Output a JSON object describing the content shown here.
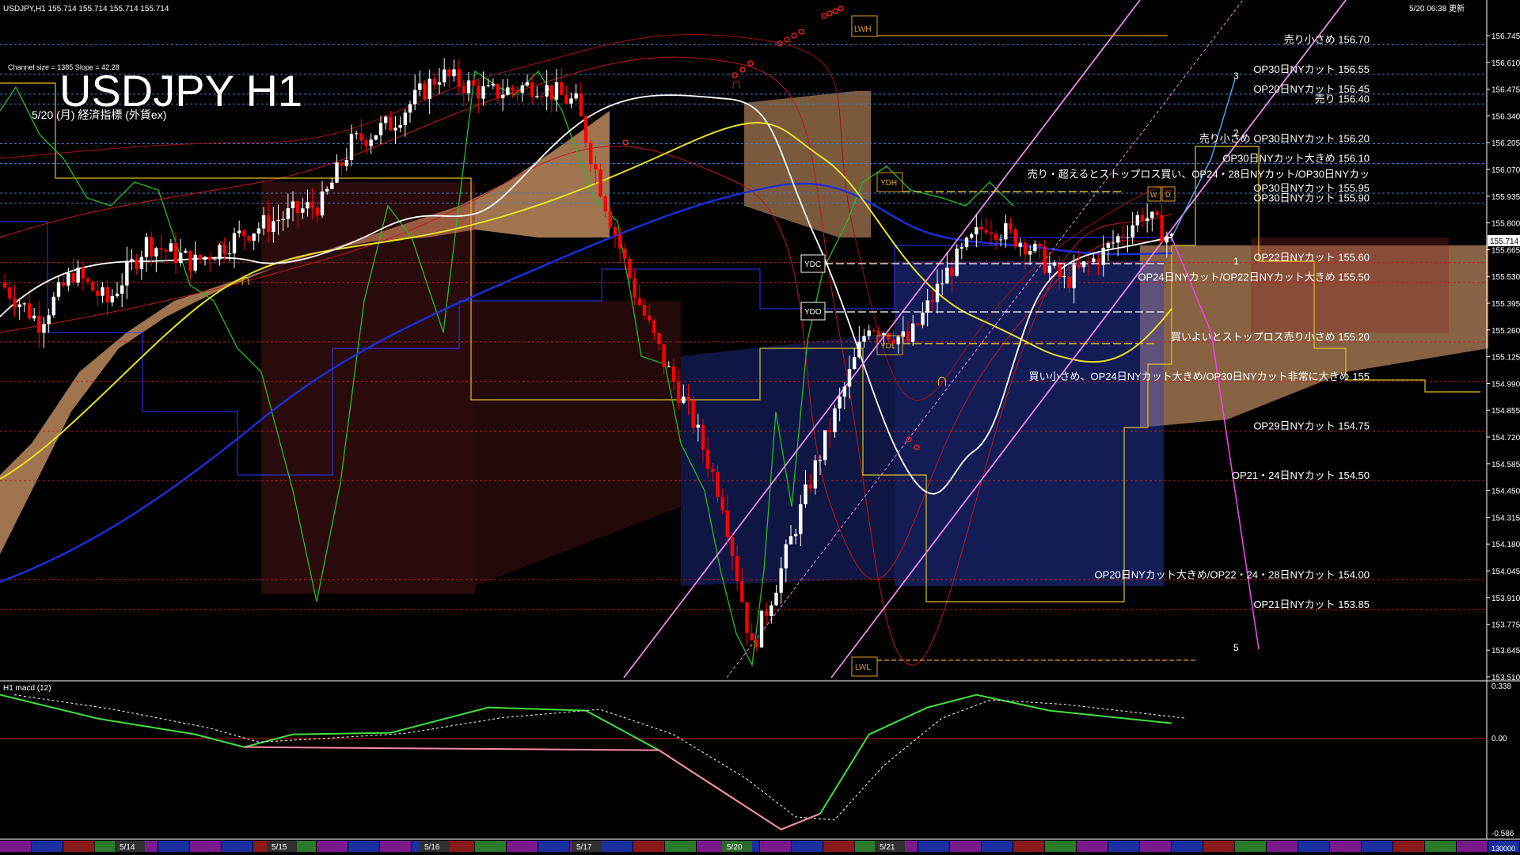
{
  "header": {
    "symbol_info": "USDJPY,H1  155.714 155.714 155.714 155.714",
    "timestamp": "5/20 06:38 更新"
  },
  "overlay": {
    "channel_info": "Channel size = 1385 Slope = 42.28",
    "big_title": "USDJPY H1",
    "subtitle": "5/20 (月) 経済指標 (外貨ex)"
  },
  "price_axis": {
    "ticks": [
      "156.745",
      "156.610",
      "156.475",
      "156.340",
      "156.205",
      "156.070",
      "155.935",
      "155.800",
      "155.665",
      "155.530",
      "155.395",
      "155.260",
      "155.125",
      "154.990",
      "154.855",
      "154.720",
      "154.585",
      "154.450",
      "154.315",
      "154.180",
      "154.045",
      "153.910",
      "153.775",
      "153.645",
      "153.510"
    ],
    "current_price": "155.714"
  },
  "level_labels": [
    {
      "text": "売り小さめ 156.70",
      "price": 156.7,
      "color": "#ffffff",
      "style": "dashed",
      "line_color": "#3a7fd0"
    },
    {
      "text": "OP30日NYカット 156.55",
      "price": 156.55,
      "color": "#ffffff",
      "style": "dashed",
      "line_color": "#3a7fd0"
    },
    {
      "text": "OP20日NYカット 156.45",
      "price": 156.45,
      "color": "#ffffff",
      "style": "dashed",
      "line_color": "#3a7fd0"
    },
    {
      "text": "売り 156.40",
      "price": 156.4,
      "color": "#ffffff",
      "style": "dashed",
      "line_color": "#3a7fd0"
    },
    {
      "text": "売り小さめ OP30日NYカット 156.20",
      "price": 156.2,
      "color": "#ffffff",
      "style": "dashed",
      "line_color": "#3a7fd0"
    },
    {
      "text": "OP30日NYカット大きめ 156.10",
      "price": 156.1,
      "color": "#ffffff",
      "style": "dashed",
      "line_color": "#3a7fd0"
    },
    {
      "text": "売り・超えるとストップロス買い、OP24・28日NYカット/OP30日NYカッ",
      "price": 156.02,
      "color": "#ffffff",
      "style": "none",
      "line_color": "#3a7fd0"
    },
    {
      "text": "OP30日NYカット 155.95",
      "price": 155.95,
      "color": "#ffffff",
      "style": "dashed",
      "line_color": "#3a7fd0"
    },
    {
      "text": "OP30日NYカット 155.90",
      "price": 155.9,
      "color": "#ffffff",
      "style": "dashed",
      "line_color": "#3a7fd0"
    },
    {
      "text": "OP22日NYカット 155.60",
      "price": 155.6,
      "color": "#ffffff",
      "style": "dashed",
      "line_color": "#c02020"
    },
    {
      "text": "OP24日NYカット/OP22日NYカット大きめ 155.50",
      "price": 155.5,
      "color": "#ffffff",
      "style": "dashed",
      "line_color": "#c02020"
    },
    {
      "text": "買いよいとストップロス売り小さめ 155.20",
      "price": 155.2,
      "color": "#ffffff",
      "style": "dashed",
      "line_color": "#c02020"
    },
    {
      "text": "買い小さめ、OP24日NYカット大きめ/OP30日NYカット非常に大きめ 155",
      "price": 155.0,
      "color": "#ffffff",
      "style": "dashed",
      "line_color": "#c02020"
    },
    {
      "text": "OP29日NYカット 154.75",
      "price": 154.75,
      "color": "#ffffff",
      "style": "dashed",
      "line_color": "#c02020"
    },
    {
      "text": "OP21・24日NYカット 154.50",
      "price": 154.5,
      "color": "#ffffff",
      "style": "dashed",
      "line_color": "#c02020"
    },
    {
      "text": "OP20日NYカット大きめ/OP22・24・28日NYカット 154.00",
      "price": 154.0,
      "color": "#ffffff",
      "style": "dashed",
      "line_color": "#c02020"
    },
    {
      "text": "OP21日NYカット 153.85",
      "price": 153.85,
      "color": "#ffffff",
      "style": "dashed",
      "line_color": "#c02020"
    }
  ],
  "markers": {
    "lwh": "LWH",
    "lwl": "LWL",
    "ydh": "YDH",
    "ydl": "YDL",
    "ydc": "YDC",
    "ydo": "YDO",
    "w": "W",
    "d": "D",
    "wave_3": "3",
    "wave_2": "2",
    "wave_1": "1",
    "wave_5": "5"
  },
  "macd": {
    "label": "H1  macd (12)",
    "ticks": [
      "0.338",
      "0.00",
      "-0.586"
    ]
  },
  "bottom_bar": {
    "dates": [
      "5/14",
      "5/15",
      "5/16",
      "5/17",
      "5/20",
      "5/21"
    ],
    "right_label": "130000"
  },
  "colors": {
    "background": "#000000",
    "bull_candle": "#ffffff",
    "bear_candle": "#ff0000",
    "ma_white": "#ffffff",
    "ma_yellow": "#e8e020",
    "ma_blue": "#1a2fe0",
    "cloud_orange": "#f5b27a",
    "cloud_blue": "#2c3fbf",
    "chikou_green": "#20c020",
    "channel_violet": "#ee88ee",
    "macd_green": "#40e040",
    "macd_pink": "#ff8aa0"
  },
  "chart_data": {
    "type": "candlestick",
    "symbol": "USDJPY",
    "timeframe": "H1",
    "ylim": [
      153.51,
      156.8
    ],
    "x_categories": [
      "5/14",
      "5/15",
      "5/16",
      "5/17",
      "5/20",
      "5/21"
    ],
    "close_path": [
      {
        "t": 0,
        "v": 155.5
      },
      {
        "t": 8,
        "v": 155.3
      },
      {
        "t": 15,
        "v": 155.55
      },
      {
        "t": 22,
        "v": 155.4
      },
      {
        "t": 30,
        "v": 155.7
      },
      {
        "t": 40,
        "v": 155.6
      },
      {
        "t": 50,
        "v": 155.75
      },
      {
        "t": 60,
        "v": 155.85
      },
      {
        "t": 66,
        "v": 155.9
      },
      {
        "t": 72,
        "v": 156.2
      },
      {
        "t": 80,
        "v": 156.3
      },
      {
        "t": 90,
        "v": 156.55
      },
      {
        "t": 100,
        "v": 156.45
      },
      {
        "t": 110,
        "v": 156.5
      },
      {
        "t": 118,
        "v": 156.4
      },
      {
        "t": 124,
        "v": 155.9
      },
      {
        "t": 130,
        "v": 155.45
      },
      {
        "t": 136,
        "v": 155.1
      },
      {
        "t": 142,
        "v": 154.8
      },
      {
        "t": 148,
        "v": 154.4
      },
      {
        "t": 154,
        "v": 153.65
      },
      {
        "t": 160,
        "v": 154.05
      },
      {
        "t": 166,
        "v": 154.5
      },
      {
        "t": 172,
        "v": 154.9
      },
      {
        "t": 178,
        "v": 155.3
      },
      {
        "t": 186,
        "v": 155.2
      },
      {
        "t": 194,
        "v": 155.55
      },
      {
        "t": 202,
        "v": 155.8
      },
      {
        "t": 210,
        "v": 155.7
      },
      {
        "t": 218,
        "v": 155.5
      },
      {
        "t": 226,
        "v": 155.65
      },
      {
        "t": 234,
        "v": 155.85
      },
      {
        "t": 240,
        "v": 155.714
      }
    ],
    "macd_path": [
      {
        "t": 0,
        "v": 0.3
      },
      {
        "t": 20,
        "v": 0.15
      },
      {
        "t": 40,
        "v": 0.05
      },
      {
        "t": 50,
        "v": -0.03
      },
      {
        "t": 60,
        "v": 0.05
      },
      {
        "t": 80,
        "v": 0.06
      },
      {
        "t": 100,
        "v": 0.22
      },
      {
        "t": 120,
        "v": 0.2
      },
      {
        "t": 135,
        "v": -0.05
      },
      {
        "t": 150,
        "v": -0.35
      },
      {
        "t": 160,
        "v": -0.55
      },
      {
        "t": 168,
        "v": -0.45
      },
      {
        "t": 178,
        "v": 0.05
      },
      {
        "t": 190,
        "v": 0.22
      },
      {
        "t": 200,
        "v": 0.3
      },
      {
        "t": 215,
        "v": 0.2
      },
      {
        "t": 240,
        "v": 0.12
      }
    ],
    "macd_ylim": [
      -0.586,
      0.338
    ]
  }
}
